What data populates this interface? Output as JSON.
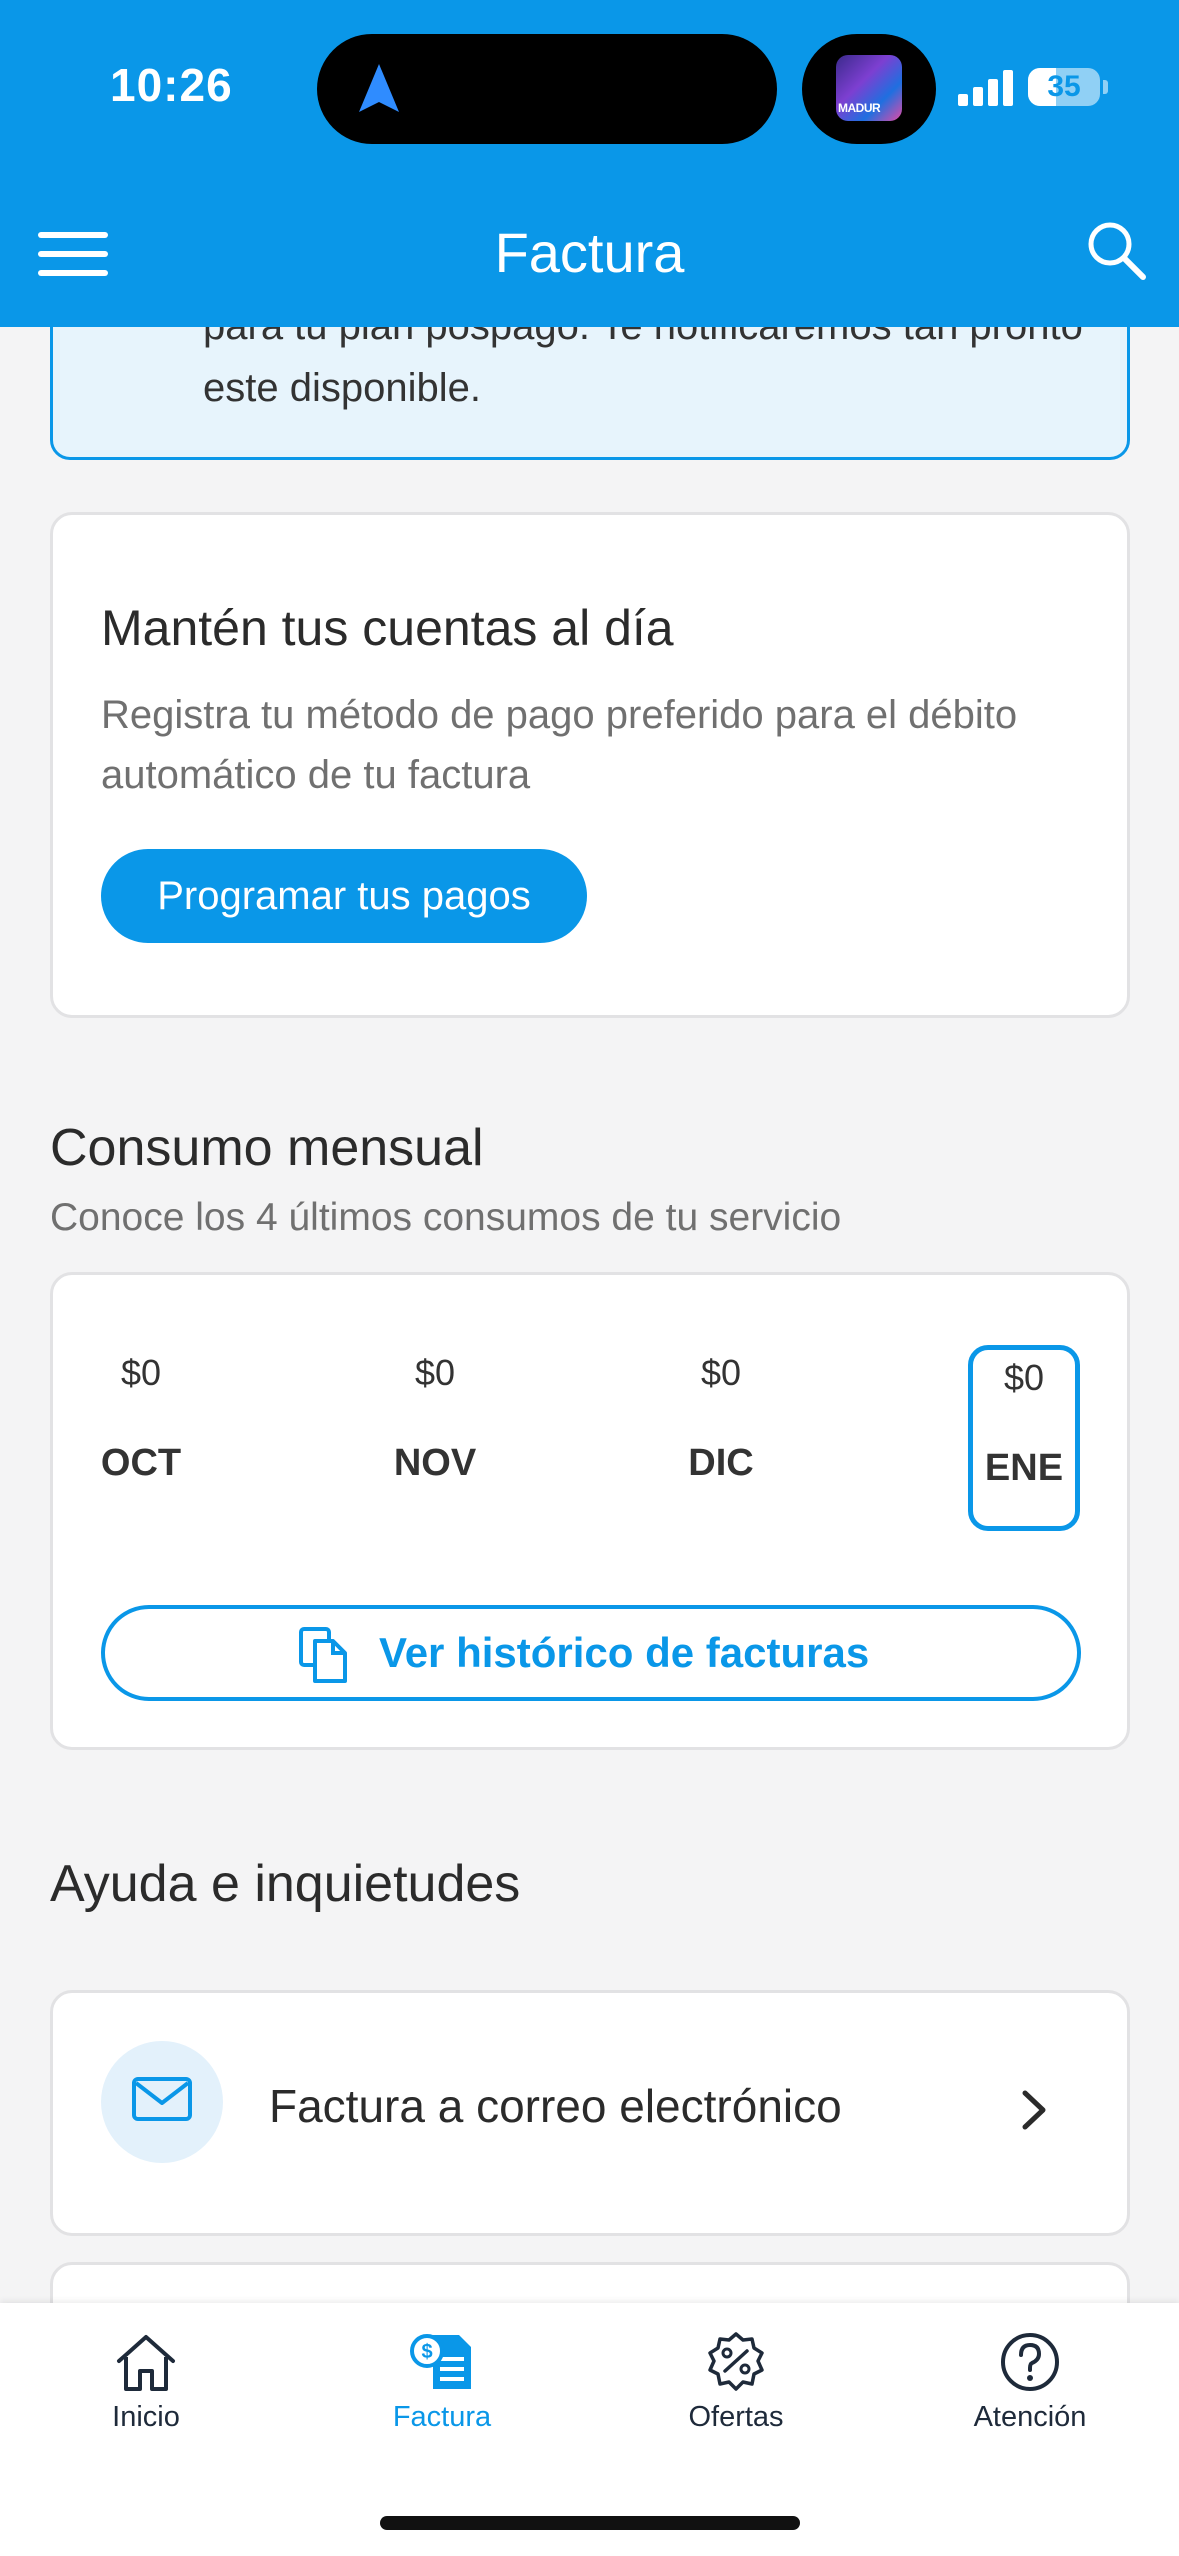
{
  "status_bar": {
    "time": "10:26",
    "battery": "35",
    "app_art_text": "MADUR"
  },
  "header": {
    "title": "Factura"
  },
  "info_banner": {
    "text": "para tu plan pospago. Te notificaremos tan pronto este disponible."
  },
  "debito_card": {
    "title": "Mantén tus cuentas al día",
    "description": "Registra tu método de pago preferido para el débito automático de tu factura",
    "button": "Programar tus pagos"
  },
  "consumo": {
    "title": "Consumo mensual",
    "subtitle": "Conoce los 4 últimos consumos de tu servicio",
    "months": [
      {
        "amount": "$0",
        "label": "OCT"
      },
      {
        "amount": "$0",
        "label": "NOV"
      },
      {
        "amount": "$0",
        "label": "DIC"
      },
      {
        "amount": "$0",
        "label": "ENE"
      }
    ],
    "selected_month": "ENE",
    "history_button": "Ver histórico de facturas"
  },
  "ayuda": {
    "title": "Ayuda e inquietudes",
    "items": [
      {
        "label": "Factura a correo electrónico",
        "icon": "envelope-icon"
      }
    ]
  },
  "bottom_nav": {
    "items": [
      {
        "label": "Inicio",
        "icon": "home-icon"
      },
      {
        "label": "Factura",
        "icon": "invoice-icon"
      },
      {
        "label": "Ofertas",
        "icon": "discount-badge-icon"
      },
      {
        "label": "Atención",
        "icon": "help-circle-icon"
      }
    ],
    "active": "Factura"
  },
  "colors": {
    "primary": "#0a97e8",
    "background": "#f4f4f5",
    "text": "#2b2b2b",
    "muted": "#707070"
  }
}
